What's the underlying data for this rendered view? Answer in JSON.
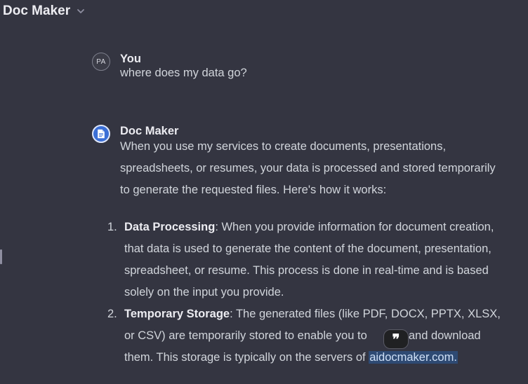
{
  "header": {
    "title": "Doc Maker",
    "chevron_icon": "chevron-down-icon"
  },
  "user_message": {
    "avatar_initials": "PA",
    "author": "You",
    "text": "where does my data go?"
  },
  "bot_message": {
    "avatar_icon": "document-icon",
    "author": "Doc Maker",
    "intro_lines": [
      "When you use my services to create documents, presentations,",
      "spreadsheets, or resumes, your data is processed and stored temporarily",
      "to generate the requested files. Here's how it works:"
    ],
    "items": [
      {
        "number": "1.",
        "title": "Data Processing",
        "lines": [
          ": When you provide information for document creation,",
          "that data is used to generate the content of the document, presentation,",
          "spreadsheet, or resume. This process is done in real-time and is based",
          "solely on the input you provide."
        ]
      },
      {
        "number": "2.",
        "title": "Temporary Storage",
        "line1": ": The generated files (like PDF, DOCX, PPTX, XLSX,",
        "line2_before": "or CSV) are temporarily stored to enable you to ",
        "line2_after": "w and download",
        "line3_before": "them. This storage is typically on the servers of ",
        "line3_highlight": "aidocmaker.com."
      }
    ]
  },
  "quote_button": {
    "symbol": "❞",
    "icon": "quote-icon"
  },
  "colors": {
    "background": "#343541",
    "text": "#d1d5db",
    "bot_avatar": "#3b6fd6",
    "highlight": "#2e4a73"
  }
}
